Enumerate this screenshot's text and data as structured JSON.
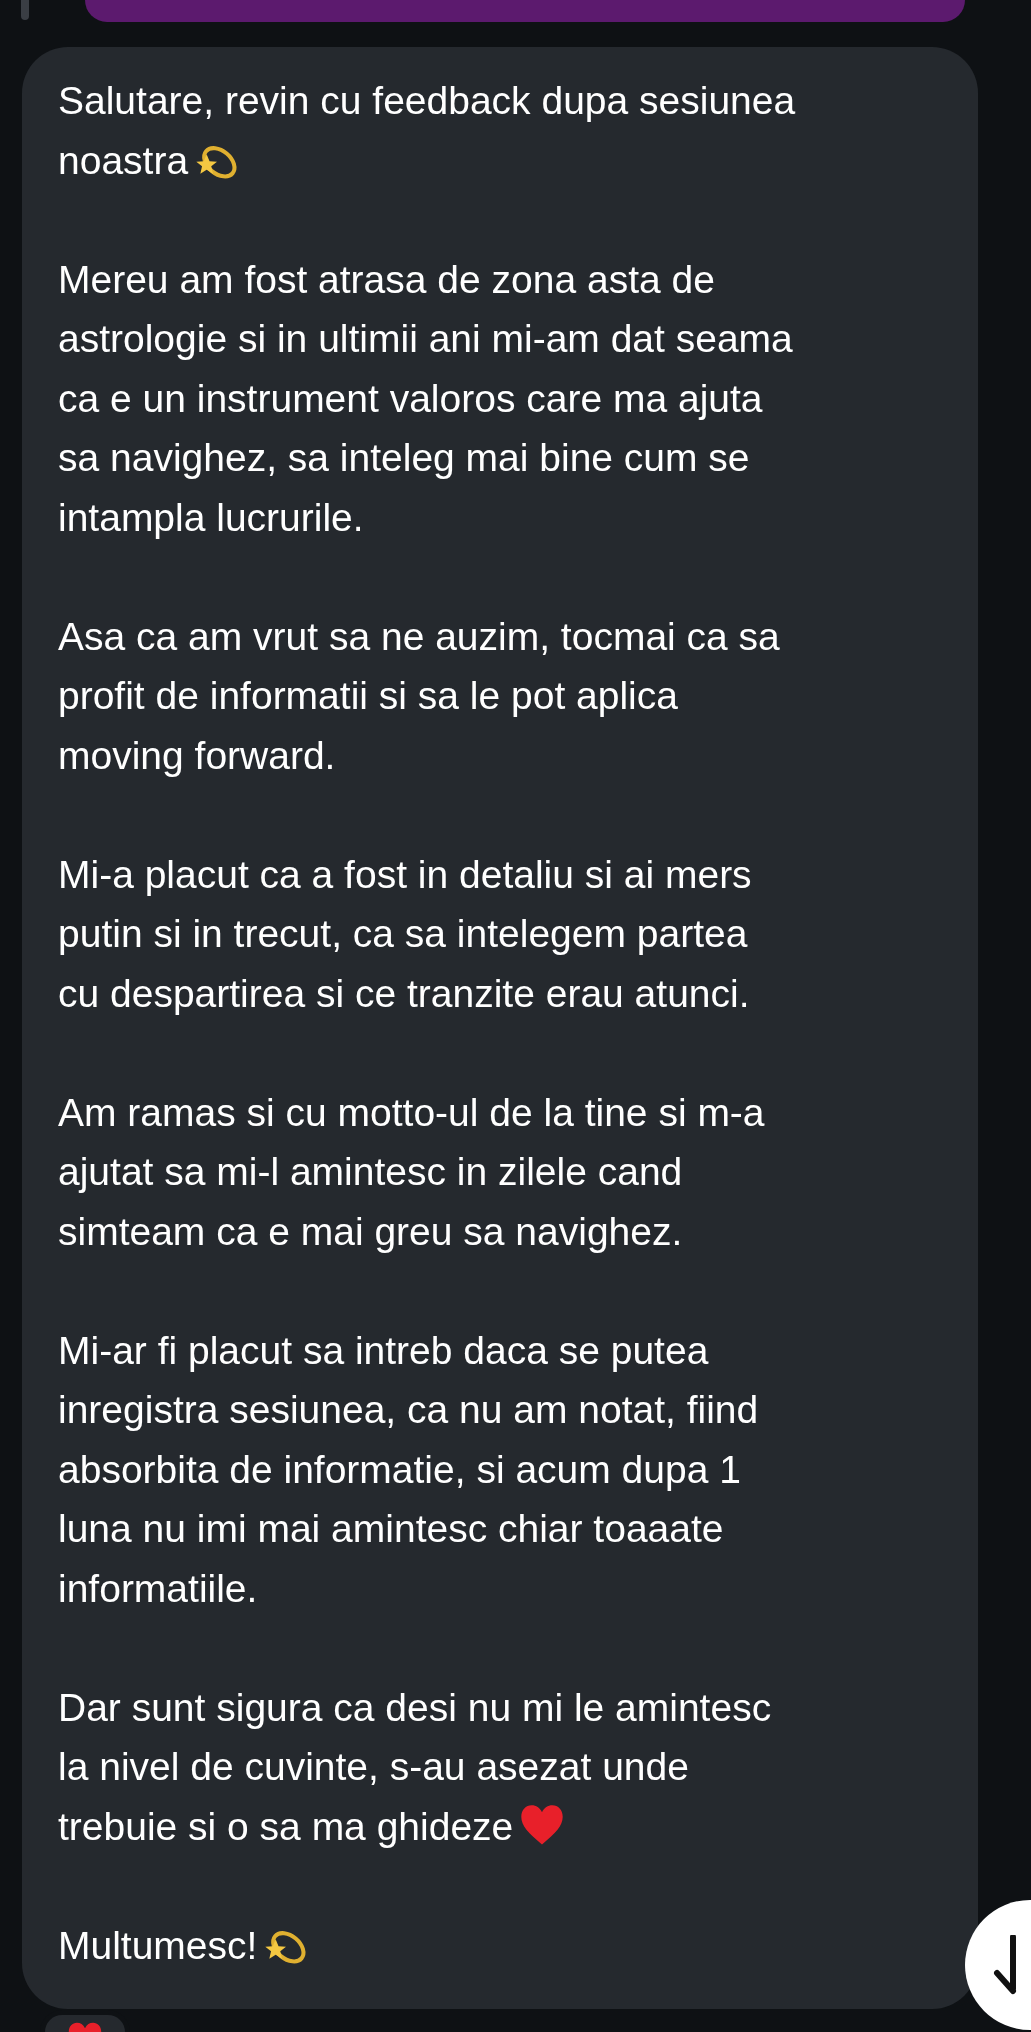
{
  "message": {
    "paragraphs": [
      {
        "kind": "star",
        "lines": [
          "Salutare, revin cu feedback dupa sesiunea",
          "noastra"
        ]
      },
      {
        "kind": "plain",
        "lines": [
          "Mereu am fost atrasa de zona asta de",
          "astrologie si in ultimii ani mi-am dat seama",
          "ca e un instrument valoros care ma ajuta",
          "sa navighez, sa inteleg mai bine cum se",
          "intampla lucrurile."
        ]
      },
      {
        "kind": "plain",
        "lines": [
          "Asa ca am vrut sa ne auzim, tocmai ca sa",
          "profit de informatii si sa le pot aplica",
          "moving forward."
        ]
      },
      {
        "kind": "plain",
        "lines": [
          "Mi-a placut ca a fost in detaliu si ai mers",
          "putin si in trecut, ca sa intelegem partea",
          "cu despartirea si ce tranzite erau atunci."
        ]
      },
      {
        "kind": "plain",
        "lines": [
          "Am ramas si cu motto-ul de la tine si m-a",
          "ajutat sa mi-l amintesc in zilele cand",
          "simteam ca e mai greu sa navighez."
        ]
      },
      {
        "kind": "plain",
        "lines": [
          "Mi-ar fi placut sa intreb daca se putea",
          "inregistra sesiunea, ca nu am notat, fiind",
          "absorbita de informatie, si acum dupa 1",
          "luna nu imi mai amintesc chiar toaaate",
          "informatiile."
        ]
      },
      {
        "kind": "heart",
        "lines": [
          "Dar sunt sigura ca desi nu mi le amintesc",
          "la nivel de cuvinte, s-au asezat unde",
          "trebuie si o sa ma ghideze"
        ]
      },
      {
        "kind": "star",
        "lines": [
          "Multumesc!"
        ]
      }
    ],
    "reaction": {
      "kind": "heart"
    }
  }
}
